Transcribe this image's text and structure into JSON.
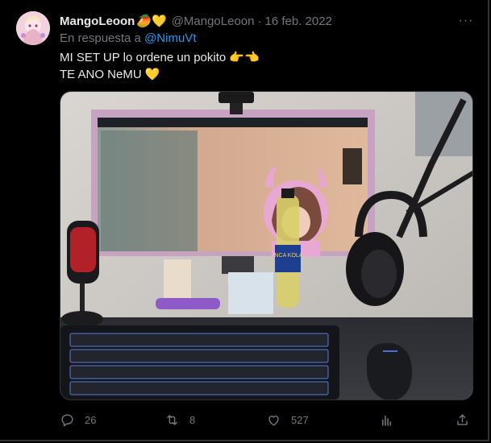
{
  "tweet": {
    "author_name": "MangoLeoon",
    "author_emojis": "🥭💛",
    "handle": "@MangoLeoon",
    "separator": "·",
    "date": "16 feb. 2022",
    "more_label": "···",
    "reply_prefix": "En respuesta a ",
    "reply_to": "@NimuVt",
    "text_line1": "MI SET UP lo ordene un pokito 👉👈",
    "text_line2": "TE ANO NeMU 💛",
    "media_bottle_label": "INCA KOLA"
  },
  "actions": {
    "replies": "26",
    "retweets": "8",
    "likes": "527"
  },
  "icons": {
    "reply": "reply-icon",
    "retweet": "retweet-icon",
    "like": "heart-icon",
    "views": "analytics-icon",
    "share": "share-icon",
    "more": "more-icon"
  },
  "colors": {
    "background": "#000000",
    "text": "#e7e9ea",
    "muted": "#71767b",
    "link": "#1d9bf0",
    "border": "#2f3336"
  }
}
